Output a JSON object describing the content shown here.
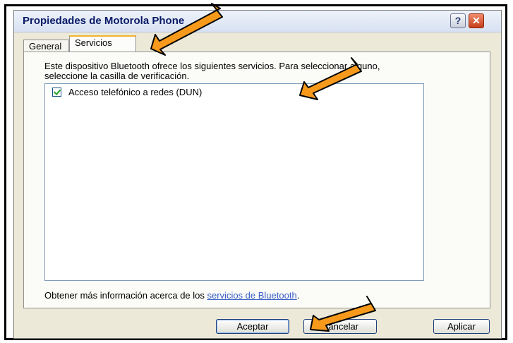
{
  "window": {
    "title": "Propiedades de Motorola Phone",
    "help_label": "?",
    "close_label": "✕"
  },
  "tabs": [
    {
      "label": "General",
      "selected": false
    },
    {
      "label": "Servicios",
      "selected": true
    }
  ],
  "panel": {
    "description": "Este dispositivo Bluetooth ofrece los siguientes servicios. Para seleccionar alguno, seleccione la casilla de verificación.",
    "services": [
      {
        "label": "Acceso telefónico a redes (DUN)",
        "checked": true
      }
    ],
    "info_prefix": "Obtener más información acerca de los ",
    "info_link": "servicios de Bluetooth",
    "info_suffix": "."
  },
  "buttons": {
    "ok": "Aceptar",
    "cancel": "Cancelar",
    "apply": "Aplicar"
  },
  "annotation": {
    "arrow_color": "#f79a1c"
  }
}
